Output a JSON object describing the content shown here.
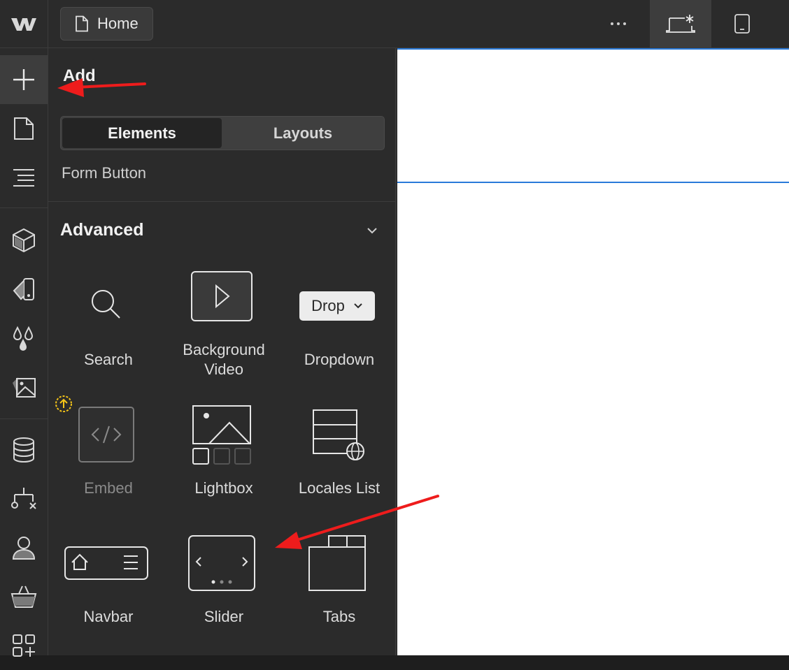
{
  "topbar": {
    "page_label": "Home",
    "icons": [
      "webflow-logo-icon",
      "page-icon",
      "more-icon",
      "desktop-breakpoint-icon",
      "tablet-breakpoint-icon"
    ]
  },
  "leftbar": {
    "icons": [
      "add-icon",
      "pages-icon",
      "navigator-icon",
      "components-icon",
      "style-selectors-icon",
      "variables-icon",
      "assets-icon",
      "cms-icon",
      "logic-icon",
      "users-icon",
      "ecommerce-icon",
      "apps-icon"
    ]
  },
  "panel": {
    "title": "Add",
    "tabs": {
      "elements": "Elements",
      "layouts": "Layouts"
    },
    "partial_item": "Form Button",
    "section_title": "Advanced",
    "tiles": {
      "search": "Search",
      "bgvideo_line1": "Background",
      "bgvideo_line2": "Video",
      "dropdown": "Dropdown",
      "dropdown_preview": "Drop",
      "embed": "Embed",
      "lightbox": "Lightbox",
      "locales": "Locales List",
      "navbar": "Navbar",
      "slider": "Slider",
      "tabs": "Tabs"
    }
  },
  "colors": {
    "panel_bg": "#2b2b2b",
    "active_tab": "#242424",
    "selection_blue": "#2a7ad9",
    "annotation_red": "#ee1c1c",
    "upgrade_badge": "#f5c518"
  }
}
